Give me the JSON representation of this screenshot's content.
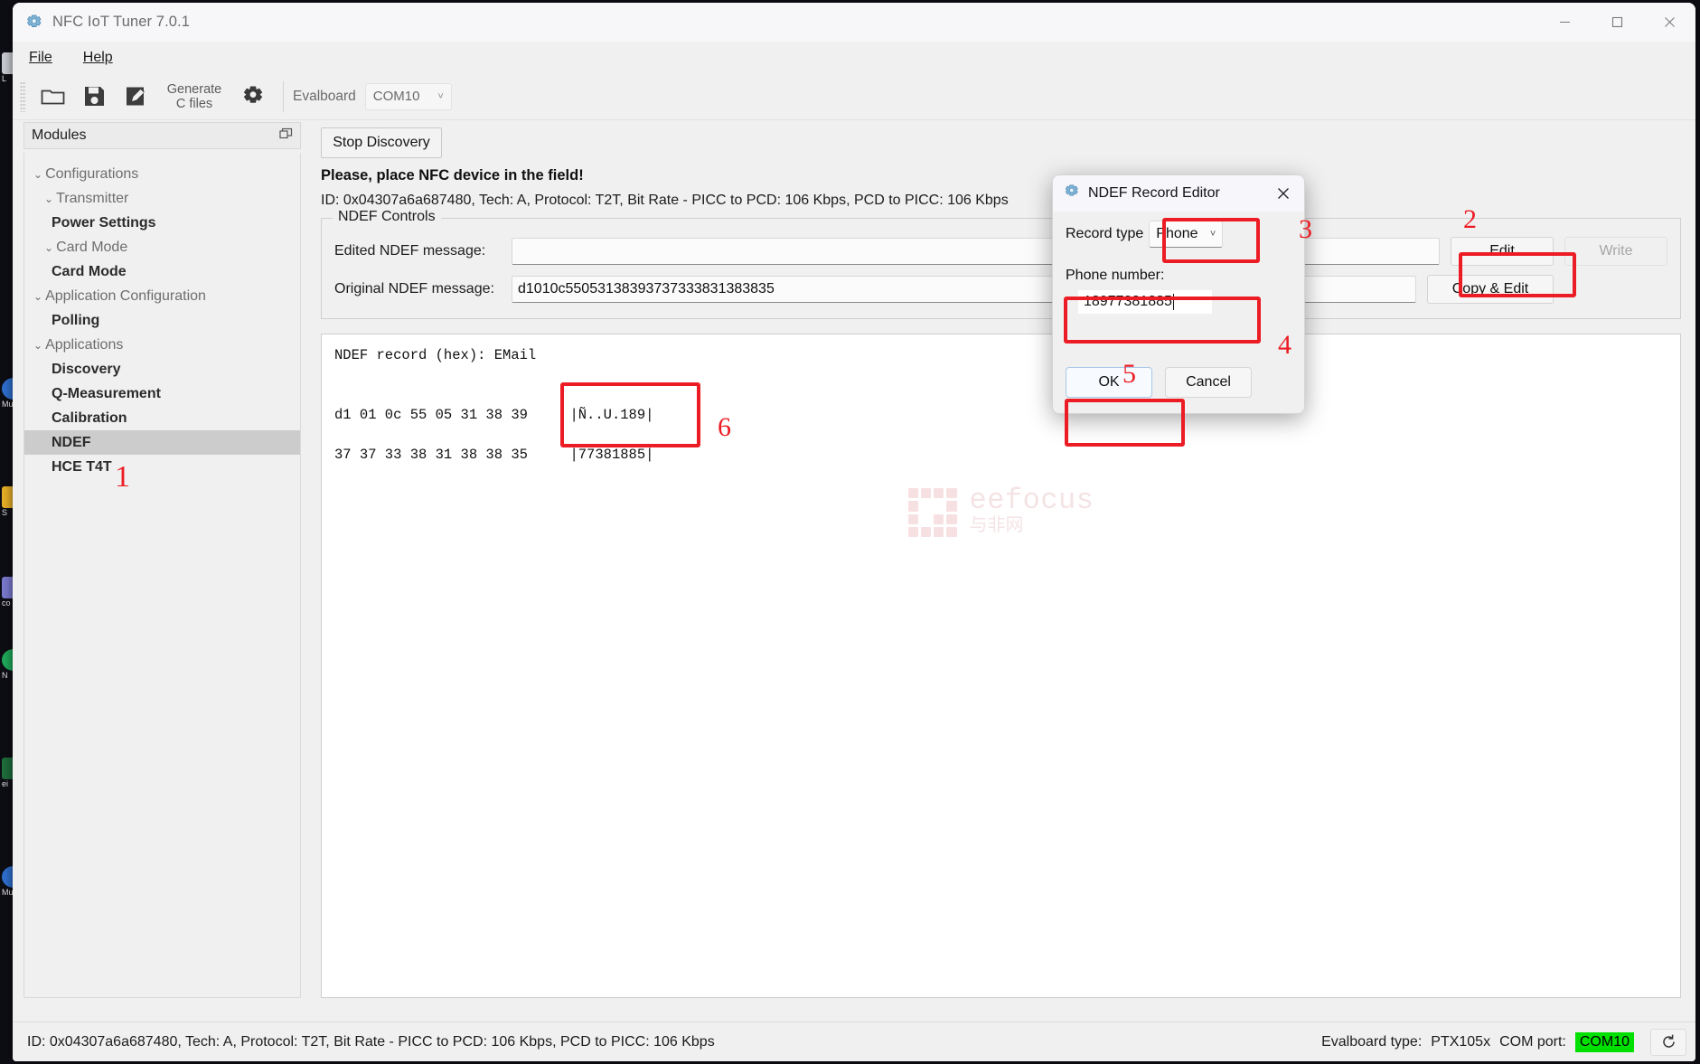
{
  "desktop": {
    "icons": [
      {
        "label": "L",
        "color": "#c9cdd2"
      },
      {
        "label": "Mu",
        "color": "#2f6fd0"
      },
      {
        "label": "S",
        "color": "#e8b028"
      },
      {
        "label": "co t",
        "color": "#7a7ad0"
      },
      {
        "label": "N",
        "color": "#1faa5a"
      },
      {
        "label": "ei",
        "color": "#1e6e3c"
      },
      {
        "label": "Mu",
        "color": "#2f6fd0"
      }
    ]
  },
  "window": {
    "title": "NFC IoT Tuner 7.0.1",
    "app_icon": "gear-app-icon",
    "minimize": "—",
    "maximize": "□",
    "close": "✕"
  },
  "menubar": {
    "items": [
      {
        "label": "File",
        "mnemonic": "F"
      },
      {
        "label": "Help",
        "mnemonic": "H"
      }
    ]
  },
  "toolbar": {
    "open_icon": "folder-open-icon",
    "save_icon": "save-disk-icon",
    "edit_icon": "edit-document-icon",
    "generate_label_line1": "Generate",
    "generate_label_line2": "C files",
    "settings_icon": "gear-icon",
    "evalboard_label": "Evalboard",
    "com_port_value": "COM10",
    "com_port_caret": "˅"
  },
  "sidebar": {
    "header": "Modules",
    "dock_icon": "undock-panel-icon",
    "tree": [
      {
        "label": "Configurations",
        "type": "group",
        "depth": 0,
        "expanded": true
      },
      {
        "label": "Transmitter",
        "type": "group",
        "depth": 1,
        "expanded": true
      },
      {
        "label": "Power Settings",
        "type": "leaf",
        "depth": 2,
        "selected": false
      },
      {
        "label": "Card Mode",
        "type": "group",
        "depth": 1,
        "expanded": true
      },
      {
        "label": "Card Mode",
        "type": "leaf",
        "depth": 2,
        "selected": false
      },
      {
        "label": "Application Configuration",
        "type": "group",
        "depth": 0,
        "expanded": true
      },
      {
        "label": "Polling",
        "type": "leaf",
        "depth": 1,
        "selected": false
      },
      {
        "label": "Applications",
        "type": "group",
        "depth": 0,
        "expanded": true
      },
      {
        "label": "Discovery",
        "type": "leaf",
        "depth": 1,
        "selected": false
      },
      {
        "label": "Q-Measurement",
        "type": "leaf",
        "depth": 1,
        "selected": false
      },
      {
        "label": "Calibration",
        "type": "leaf",
        "depth": 1,
        "selected": false
      },
      {
        "label": "NDEF",
        "type": "leaf",
        "depth": 1,
        "selected": true
      },
      {
        "label": "HCE T4T",
        "type": "leaf",
        "depth": 1,
        "selected": false
      }
    ]
  },
  "main": {
    "stop_discovery_label": "Stop Discovery",
    "prompt": "Please, place NFC device in the field!",
    "tag_info": "ID: 0x04307a6a687480, Tech: A, Protocol: T2T, Bit Rate - PICC to PCD: 106 Kbps, PCD to PICC: 106 Kbps",
    "groupbox_legend": "NDEF Controls",
    "rows": [
      {
        "label": "Edited NDEF message:",
        "value": "",
        "button": "Edit",
        "button2": "Write",
        "button2_disabled": true
      },
      {
        "label": "Original NDEF message:",
        "value": "d1010c55053138393737333831383835",
        "button": "Copy & Edit",
        "button2": "",
        "button2_disabled": false
      }
    ],
    "hex_header": "NDEF record (hex): EMail",
    "hex_lines": [
      "d1 01 0c 55 05 31 38 39     |Ñ..U.189|",
      "37 37 33 38 31 38 38 35     |77381885|"
    ],
    "watermark": {
      "en": "eefocus",
      "cn": "与非网"
    }
  },
  "dialog": {
    "title": "NDEF Record Editor",
    "app_icon": "gear-app-icon",
    "close_icon": "close-icon",
    "record_type_label": "Record type",
    "record_type_value": "Phone",
    "record_type_caret": "˅",
    "phone_label": "Phone number:",
    "phone_value": "18977381885",
    "ok_label": "OK",
    "cancel_label": "Cancel"
  },
  "statusbar": {
    "left": "ID: 0x04307a6a687480, Tech: A, Protocol: T2T, Bit Rate - PICC to PCD: 106 Kbps, PCD to PICC: 106 Kbps",
    "evalboard_type_label": "Evalboard type:",
    "evalboard_type_value": "PTX105x",
    "com_port_label": "COM port:",
    "com_port_value": "COM10",
    "com_port_color": "#00e000",
    "refresh_icon": "refresh-icon"
  },
  "annotations": {
    "accent_color": "#ec1c24",
    "markers": [
      {
        "id": "1",
        "target": "sidebar-ndef-hce"
      },
      {
        "id": "2",
        "target": "edit-button"
      },
      {
        "id": "3",
        "target": "record-type-combo"
      },
      {
        "id": "4",
        "target": "phone-input"
      },
      {
        "id": "5",
        "target": "ok-button"
      },
      {
        "id": "6",
        "target": "hex-ascii-column"
      }
    ]
  }
}
